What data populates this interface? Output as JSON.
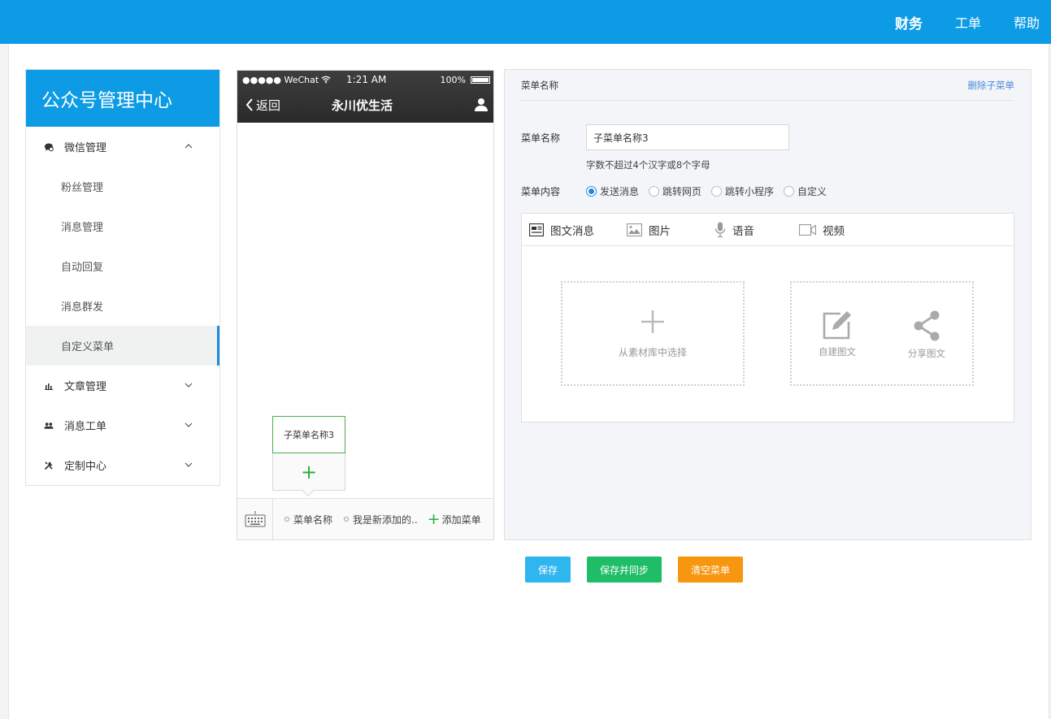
{
  "topnav": {
    "items": [
      "财务",
      "工单",
      "帮助"
    ]
  },
  "sidebar": {
    "title": "公众号管理中心",
    "groups": {
      "wechat": {
        "label": "微信管理",
        "icon": "chat-bubble-icon"
      },
      "article": {
        "label": "文章管理",
        "icon": "bar-chart-icon"
      },
      "ticket": {
        "label": "消息工单",
        "icon": "users-icon"
      },
      "custom": {
        "label": "定制中心",
        "icon": "tools-icon"
      }
    },
    "sub_items": [
      "粉丝管理",
      "消息管理",
      "自动回复",
      "消息群发",
      "自定义菜单"
    ]
  },
  "phone": {
    "carrier": "●●●●● WeChat",
    "time": "1:21 AM",
    "battery": "100%",
    "back_label": "返回",
    "title": "永川优生活",
    "submenu_item": "子菜单名称3",
    "submenu_add": "+",
    "menu_items": [
      "菜单名称",
      "我是新添加的.."
    ],
    "add_menu": "添加菜单"
  },
  "editor": {
    "header_label": "菜单名称",
    "delete_label": "删除子菜单",
    "name_label": "菜单名称",
    "name_value": "子菜单名称3",
    "name_hint": "字数不超过4个汉字或8个字母",
    "content_label": "菜单内容",
    "radios": [
      "发送消息",
      "跳转网页",
      "跳转小程序",
      "自定义"
    ],
    "selected_radio": "发送消息",
    "tabs": [
      "图文消息",
      "图片",
      "语音",
      "视频"
    ],
    "pick_library": "从素材库中选择",
    "create_article": "自建图文",
    "share_article": "分享图文"
  },
  "buttons": {
    "save": "保存",
    "save_sync": "保存并同步",
    "clear": "清空菜单"
  },
  "colors": {
    "brand_blue": "#0d9be6",
    "save": "#2fb6ee",
    "save_sync": "#1fbd67",
    "clear": "#f7960f",
    "green_accent": "#2aad3b"
  }
}
